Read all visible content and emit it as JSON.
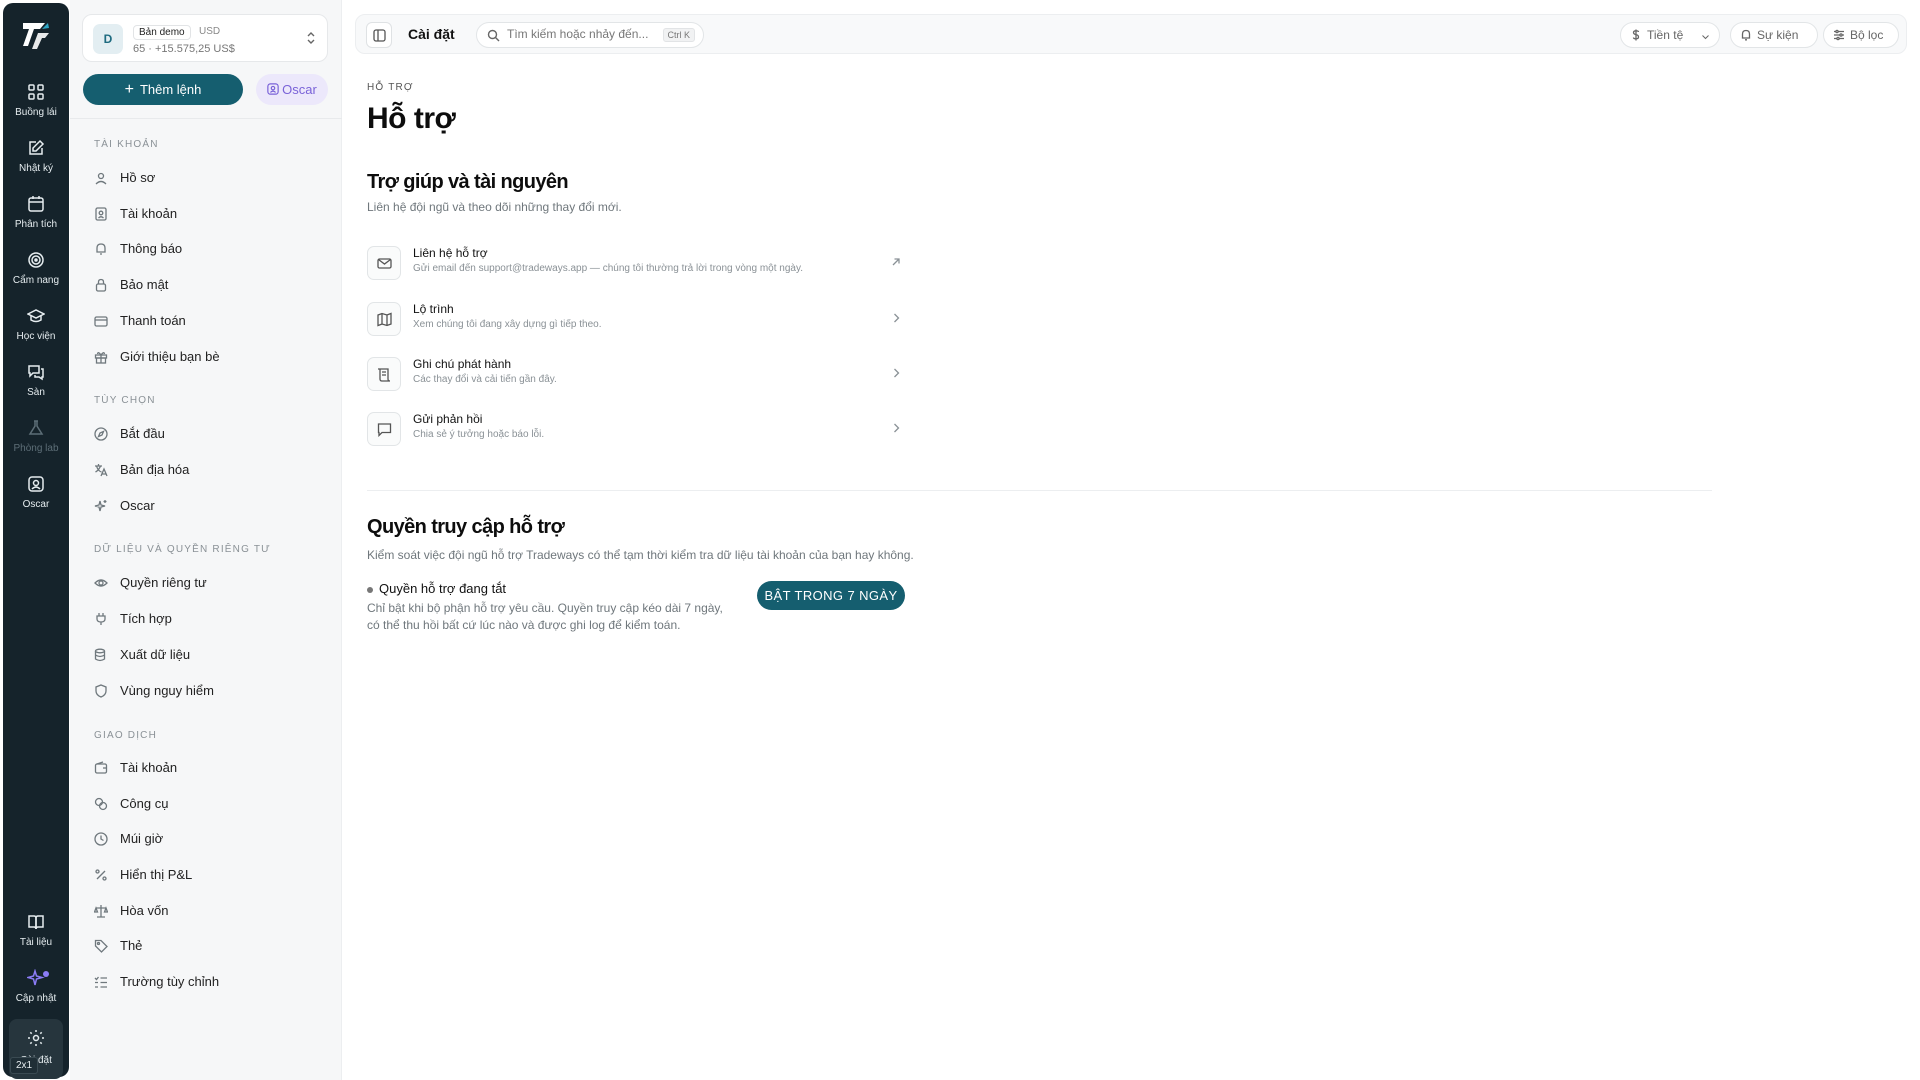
{
  "rail": {
    "items": [
      {
        "label": "Buồng lái",
        "icon": "dashboard-icon"
      },
      {
        "label": "Nhật ký",
        "icon": "journal-icon"
      },
      {
        "label": "Phân tích",
        "icon": "calendar-icon"
      },
      {
        "label": "Cẩm nang",
        "icon": "target-icon"
      },
      {
        "label": "Học viện",
        "icon": "graduation-cap-icon"
      },
      {
        "label": "Sàn",
        "icon": "chat-icon"
      },
      {
        "label": "Phòng lab",
        "icon": "flask-icon"
      },
      {
        "label": "Oscar",
        "icon": "oscar-icon"
      }
    ],
    "bottom": [
      {
        "label": "Tài liệu",
        "icon": "book-icon"
      },
      {
        "label": "Cập nhật",
        "icon": "sparkle-icon"
      },
      {
        "label": "Cài đặt",
        "icon": "gear-icon"
      }
    ],
    "badge": "2x1"
  },
  "account": {
    "avatar": "D",
    "name": "Bản demo",
    "currency": "USD",
    "sub": "65 · +15.575,25 US$"
  },
  "sidebar": {
    "add_order": "Thêm lệnh",
    "oscar": "Oscar",
    "sections": [
      {
        "title": "Tài khoản",
        "items": [
          "Hồ sơ",
          "Tài khoản",
          "Thông báo",
          "Bảo mật",
          "Thanh toán",
          "Giới thiệu bạn bè"
        ]
      },
      {
        "title": "Tùy chọn",
        "items": [
          "Bắt đầu",
          "Bản địa hóa",
          "Oscar"
        ]
      },
      {
        "title": "Dữ liệu và quyền riêng tư",
        "items": [
          "Quyền riêng tư",
          "Tích hợp",
          "Xuất dữ liệu",
          "Vùng nguy hiểm"
        ]
      },
      {
        "title": "Giao dịch",
        "items": [
          "Tài khoản",
          "Công cụ",
          "Múi giờ",
          "Hiển thị P&L",
          "Hòa vốn",
          "Thẻ",
          "Trường tùy chỉnh"
        ]
      }
    ]
  },
  "topbar": {
    "title": "Cài đặt",
    "search_placeholder": "Tìm kiếm hoặc nhảy đến...",
    "shortcut": "Ctrl K",
    "currency": "Tiền tệ",
    "events": "Sự kiện",
    "filter": "Bộ lọc"
  },
  "main": {
    "breadcrumb": "HỖ TRỢ",
    "title": "Hỗ trợ",
    "resources_title": "Trợ giúp và tài nguyên",
    "resources_desc": "Liên hệ đội ngũ và theo dõi những thay đổi mới.",
    "resources": [
      {
        "title": "Liên hệ hỗ trợ",
        "sub": "Gửi email đến support@tradeways.app — chúng tôi thường trả lời trong vòng một ngày.",
        "icon": "mail-icon",
        "arrow": "external-link-icon"
      },
      {
        "title": "Lộ trình",
        "sub": "Xem chúng tôi đang xây dựng gì tiếp theo.",
        "icon": "map-icon",
        "arrow": "chevron-right-icon"
      },
      {
        "title": "Ghi chú phát hành",
        "sub": "Các thay đổi và cải tiến gần đây.",
        "icon": "scroll-icon",
        "arrow": "chevron-right-icon"
      },
      {
        "title": "Gửi phản hồi",
        "sub": "Chia sẻ ý tưởng hoặc báo lỗi.",
        "icon": "message-icon",
        "arrow": "chevron-right-icon"
      }
    ],
    "access_title": "Quyền truy cập hỗ trợ",
    "access_desc": "Kiểm soát việc đội ngũ hỗ trợ Tradeways có thể tạm thời kiểm tra dữ liệu tài khoản của bạn hay không.",
    "access_status": "Quyền hỗ trợ đang tắt",
    "access_note": "Chỉ bật khi bộ phận hỗ trợ yêu cầu. Quyền truy cập kéo dài 7 ngày, có thể thu hồi bất cứ lúc nào và được ghi log để kiểm toán.",
    "enable_button": "BẬT TRONG 7 NGÀY"
  },
  "colors": {
    "accent": "#155e6f",
    "rail": "#15232b",
    "oscar": "#7a63d8"
  }
}
